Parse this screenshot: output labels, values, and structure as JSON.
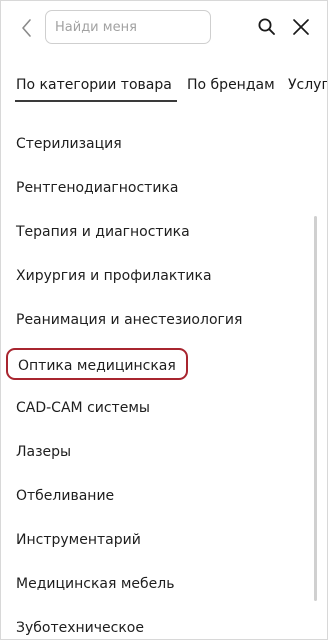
{
  "search": {
    "placeholder": "Найди меня",
    "value": ""
  },
  "tabs": [
    {
      "label": "По категории товара",
      "active": true
    },
    {
      "label": "По брендам",
      "active": false
    },
    {
      "label": "Услуги",
      "active": false
    }
  ],
  "categories": [
    {
      "label": "Стерилизация"
    },
    {
      "label": "Рентгенодиагностика"
    },
    {
      "label": "Терапия и диагностика"
    },
    {
      "label": "Хирургия и профилактика"
    },
    {
      "label": "Реанимация и анестезиология"
    },
    {
      "label": "Оптика медицинская",
      "highlighted": true
    },
    {
      "label": "CAD-CAM системы"
    },
    {
      "label": "Лазеры"
    },
    {
      "label": "Отбеливание"
    },
    {
      "label": "Инструментарий"
    },
    {
      "label": "Медицинская мебель"
    },
    {
      "label": "Зуботехническое"
    }
  ],
  "icons": {
    "back": "chevron-left-icon",
    "search": "search-icon",
    "close": "close-icon"
  },
  "colors": {
    "highlight_border": "#a8252f",
    "active_tab_underline": "#3a3a3a"
  }
}
